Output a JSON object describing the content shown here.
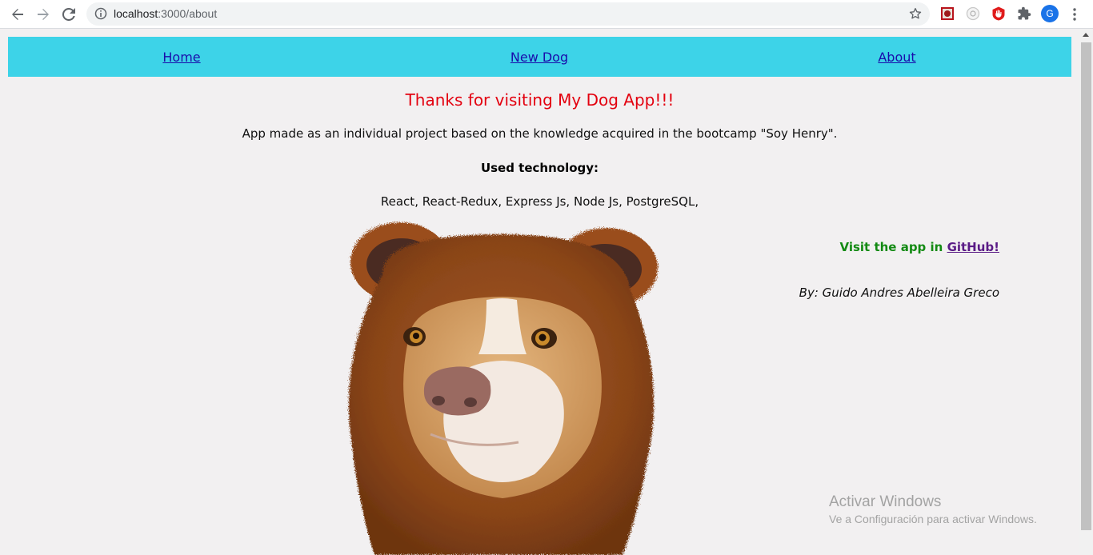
{
  "browser": {
    "url_host": "localhost",
    "url_path": ":3000/about",
    "profile_initial": "G",
    "icons": [
      "back-arrow-icon",
      "forward-arrow-icon",
      "reload-icon",
      "info-icon",
      "star-icon",
      "extension-icon",
      "puzzle-icon",
      "more-vert-icon"
    ]
  },
  "navbar": {
    "home": "Home",
    "new_dog": "New Dog",
    "about": "About",
    "color": "#3dd3e8"
  },
  "about": {
    "title": "Thanks for visiting My Dog App!!!",
    "description": "App made as an individual project based on the knowledge acquired in the bootcamp \"Soy Henry\".",
    "tech_heading": "Used technology:",
    "tech_list": "React, React-Redux, Express Js, Node Js, PostgreSQL,",
    "visit_prefix": "Visit the app in ",
    "visit_link": "GitHub!",
    "author": "By: Guido Andres Abelleira Greco"
  },
  "watermark": {
    "title": "Activar Windows",
    "subtitle": "Ve a Configuración para activar Windows."
  }
}
